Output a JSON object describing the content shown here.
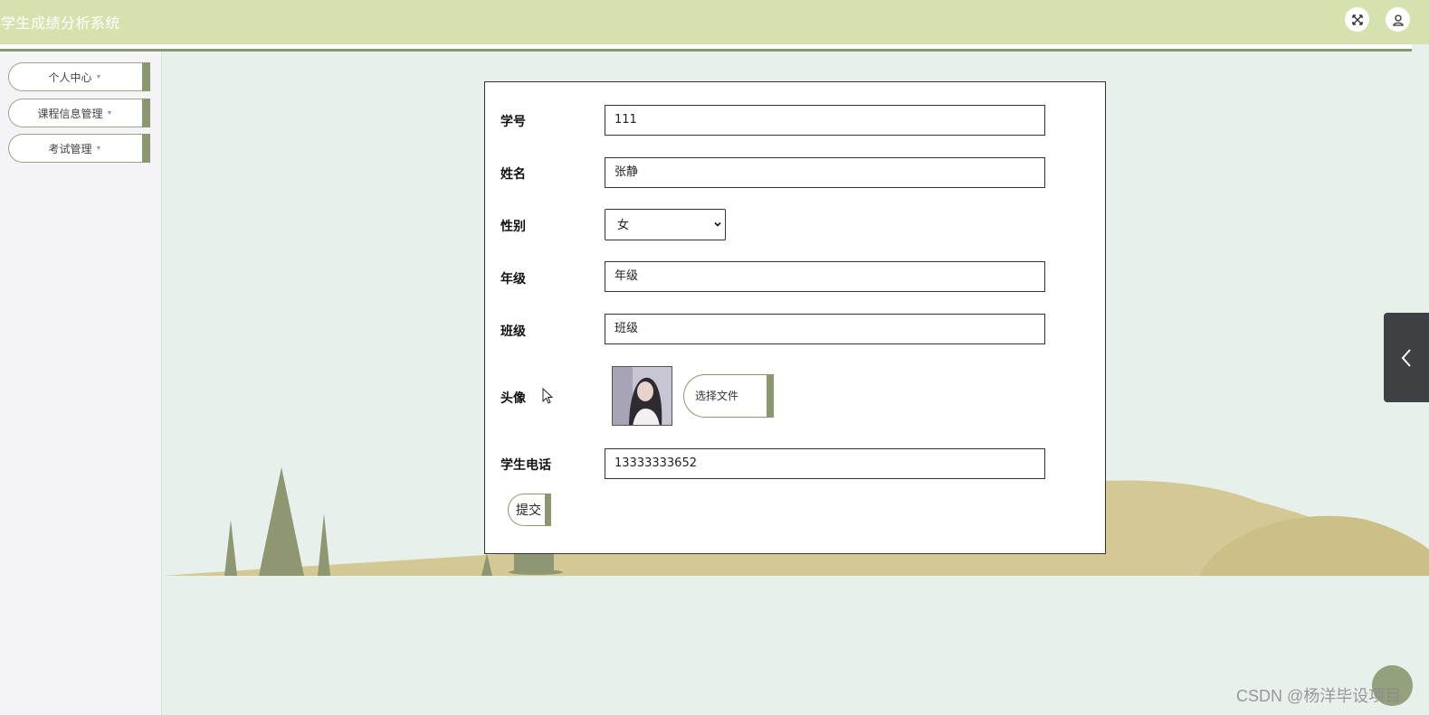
{
  "header": {
    "title": "学生成绩分析系统",
    "fullscreen_icon": "fullscreen-icon",
    "user_icon": "user-icon"
  },
  "sidebar": {
    "items": [
      {
        "label": "个人中心"
      },
      {
        "label": "课程信息管理"
      },
      {
        "label": "考试管理"
      }
    ]
  },
  "form": {
    "fields": {
      "student_id": {
        "label": "学号",
        "value": "111"
      },
      "name": {
        "label": "姓名",
        "value": "张静"
      },
      "gender": {
        "label": "性别",
        "value": "女"
      },
      "grade": {
        "label": "年级",
        "placeholder": "年级"
      },
      "class": {
        "label": "班级",
        "placeholder": "班级"
      },
      "avatar": {
        "label": "头像",
        "button": "选择文件"
      },
      "phone": {
        "label": "学生电话",
        "value": "13333333652"
      }
    },
    "submit_label": "提交"
  },
  "watermark": "CSDN @杨洋毕设项目",
  "colors": {
    "header_bg": "#d5e2ae",
    "accent": "#8a9870",
    "content_bg": "#e8f0ec",
    "hill": "#d4c995",
    "tree": "#8f9772"
  }
}
